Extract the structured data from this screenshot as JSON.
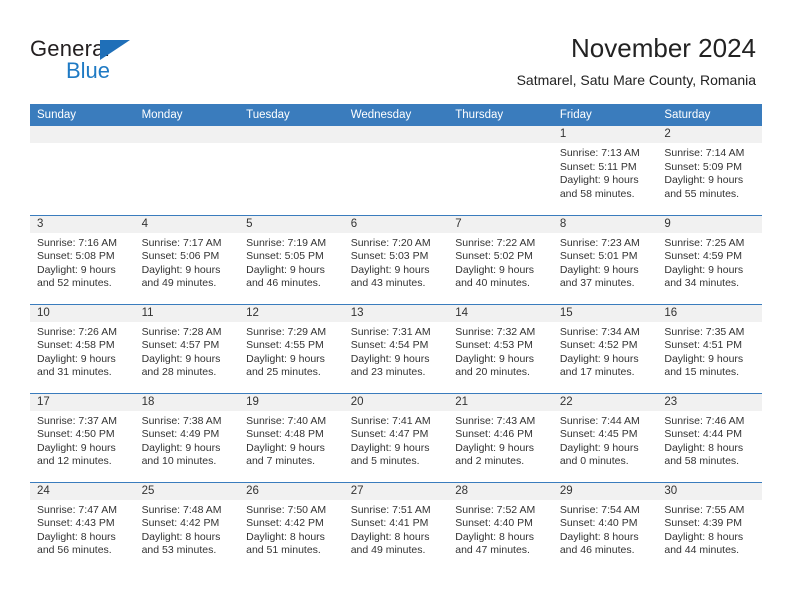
{
  "brand": {
    "word1": "General",
    "word2": "Blue",
    "triangle_color": "#1f6fb8",
    "blue_text_color": "#1f7ac4"
  },
  "header": {
    "title": "November 2024",
    "subtitle": "Satmarel, Satu Mare County, Romania"
  },
  "theme": {
    "header_bar": "#3a7cbd",
    "daynum_band": "#f1f1f1",
    "text": "#333333"
  },
  "weekdays": [
    "Sunday",
    "Monday",
    "Tuesday",
    "Wednesday",
    "Thursday",
    "Friday",
    "Saturday"
  ],
  "labels": {
    "sunrise_prefix": "Sunrise: ",
    "sunset_prefix": "Sunset: ",
    "daylight_prefix": "Daylight: "
  },
  "weeks": [
    [
      {
        "day": "",
        "empty": true
      },
      {
        "day": "",
        "empty": true
      },
      {
        "day": "",
        "empty": true
      },
      {
        "day": "",
        "empty": true
      },
      {
        "day": "",
        "empty": true
      },
      {
        "day": "1",
        "sunrise": "Sunrise: 7:13 AM",
        "sunset": "Sunset: 5:11 PM",
        "daylight1": "Daylight: 9 hours",
        "daylight2": "and 58 minutes."
      },
      {
        "day": "2",
        "sunrise": "Sunrise: 7:14 AM",
        "sunset": "Sunset: 5:09 PM",
        "daylight1": "Daylight: 9 hours",
        "daylight2": "and 55 minutes."
      }
    ],
    [
      {
        "day": "3",
        "sunrise": "Sunrise: 7:16 AM",
        "sunset": "Sunset: 5:08 PM",
        "daylight1": "Daylight: 9 hours",
        "daylight2": "and 52 minutes."
      },
      {
        "day": "4",
        "sunrise": "Sunrise: 7:17 AM",
        "sunset": "Sunset: 5:06 PM",
        "daylight1": "Daylight: 9 hours",
        "daylight2": "and 49 minutes."
      },
      {
        "day": "5",
        "sunrise": "Sunrise: 7:19 AM",
        "sunset": "Sunset: 5:05 PM",
        "daylight1": "Daylight: 9 hours",
        "daylight2": "and 46 minutes."
      },
      {
        "day": "6",
        "sunrise": "Sunrise: 7:20 AM",
        "sunset": "Sunset: 5:03 PM",
        "daylight1": "Daylight: 9 hours",
        "daylight2": "and 43 minutes."
      },
      {
        "day": "7",
        "sunrise": "Sunrise: 7:22 AM",
        "sunset": "Sunset: 5:02 PM",
        "daylight1": "Daylight: 9 hours",
        "daylight2": "and 40 minutes."
      },
      {
        "day": "8",
        "sunrise": "Sunrise: 7:23 AM",
        "sunset": "Sunset: 5:01 PM",
        "daylight1": "Daylight: 9 hours",
        "daylight2": "and 37 minutes."
      },
      {
        "day": "9",
        "sunrise": "Sunrise: 7:25 AM",
        "sunset": "Sunset: 4:59 PM",
        "daylight1": "Daylight: 9 hours",
        "daylight2": "and 34 minutes."
      }
    ],
    [
      {
        "day": "10",
        "sunrise": "Sunrise: 7:26 AM",
        "sunset": "Sunset: 4:58 PM",
        "daylight1": "Daylight: 9 hours",
        "daylight2": "and 31 minutes."
      },
      {
        "day": "11",
        "sunrise": "Sunrise: 7:28 AM",
        "sunset": "Sunset: 4:57 PM",
        "daylight1": "Daylight: 9 hours",
        "daylight2": "and 28 minutes."
      },
      {
        "day": "12",
        "sunrise": "Sunrise: 7:29 AM",
        "sunset": "Sunset: 4:55 PM",
        "daylight1": "Daylight: 9 hours",
        "daylight2": "and 25 minutes."
      },
      {
        "day": "13",
        "sunrise": "Sunrise: 7:31 AM",
        "sunset": "Sunset: 4:54 PM",
        "daylight1": "Daylight: 9 hours",
        "daylight2": "and 23 minutes."
      },
      {
        "day": "14",
        "sunrise": "Sunrise: 7:32 AM",
        "sunset": "Sunset: 4:53 PM",
        "daylight1": "Daylight: 9 hours",
        "daylight2": "and 20 minutes."
      },
      {
        "day": "15",
        "sunrise": "Sunrise: 7:34 AM",
        "sunset": "Sunset: 4:52 PM",
        "daylight1": "Daylight: 9 hours",
        "daylight2": "and 17 minutes."
      },
      {
        "day": "16",
        "sunrise": "Sunrise: 7:35 AM",
        "sunset": "Sunset: 4:51 PM",
        "daylight1": "Daylight: 9 hours",
        "daylight2": "and 15 minutes."
      }
    ],
    [
      {
        "day": "17",
        "sunrise": "Sunrise: 7:37 AM",
        "sunset": "Sunset: 4:50 PM",
        "daylight1": "Daylight: 9 hours",
        "daylight2": "and 12 minutes."
      },
      {
        "day": "18",
        "sunrise": "Sunrise: 7:38 AM",
        "sunset": "Sunset: 4:49 PM",
        "daylight1": "Daylight: 9 hours",
        "daylight2": "and 10 minutes."
      },
      {
        "day": "19",
        "sunrise": "Sunrise: 7:40 AM",
        "sunset": "Sunset: 4:48 PM",
        "daylight1": "Daylight: 9 hours",
        "daylight2": "and 7 minutes."
      },
      {
        "day": "20",
        "sunrise": "Sunrise: 7:41 AM",
        "sunset": "Sunset: 4:47 PM",
        "daylight1": "Daylight: 9 hours",
        "daylight2": "and 5 minutes."
      },
      {
        "day": "21",
        "sunrise": "Sunrise: 7:43 AM",
        "sunset": "Sunset: 4:46 PM",
        "daylight1": "Daylight: 9 hours",
        "daylight2": "and 2 minutes."
      },
      {
        "day": "22",
        "sunrise": "Sunrise: 7:44 AM",
        "sunset": "Sunset: 4:45 PM",
        "daylight1": "Daylight: 9 hours",
        "daylight2": "and 0 minutes."
      },
      {
        "day": "23",
        "sunrise": "Sunrise: 7:46 AM",
        "sunset": "Sunset: 4:44 PM",
        "daylight1": "Daylight: 8 hours",
        "daylight2": "and 58 minutes."
      }
    ],
    [
      {
        "day": "24",
        "sunrise": "Sunrise: 7:47 AM",
        "sunset": "Sunset: 4:43 PM",
        "daylight1": "Daylight: 8 hours",
        "daylight2": "and 56 minutes."
      },
      {
        "day": "25",
        "sunrise": "Sunrise: 7:48 AM",
        "sunset": "Sunset: 4:42 PM",
        "daylight1": "Daylight: 8 hours",
        "daylight2": "and 53 minutes."
      },
      {
        "day": "26",
        "sunrise": "Sunrise: 7:50 AM",
        "sunset": "Sunset: 4:42 PM",
        "daylight1": "Daylight: 8 hours",
        "daylight2": "and 51 minutes."
      },
      {
        "day": "27",
        "sunrise": "Sunrise: 7:51 AM",
        "sunset": "Sunset: 4:41 PM",
        "daylight1": "Daylight: 8 hours",
        "daylight2": "and 49 minutes."
      },
      {
        "day": "28",
        "sunrise": "Sunrise: 7:52 AM",
        "sunset": "Sunset: 4:40 PM",
        "daylight1": "Daylight: 8 hours",
        "daylight2": "and 47 minutes."
      },
      {
        "day": "29",
        "sunrise": "Sunrise: 7:54 AM",
        "sunset": "Sunset: 4:40 PM",
        "daylight1": "Daylight: 8 hours",
        "daylight2": "and 46 minutes."
      },
      {
        "day": "30",
        "sunrise": "Sunrise: 7:55 AM",
        "sunset": "Sunset: 4:39 PM",
        "daylight1": "Daylight: 8 hours",
        "daylight2": "and 44 minutes."
      }
    ]
  ]
}
